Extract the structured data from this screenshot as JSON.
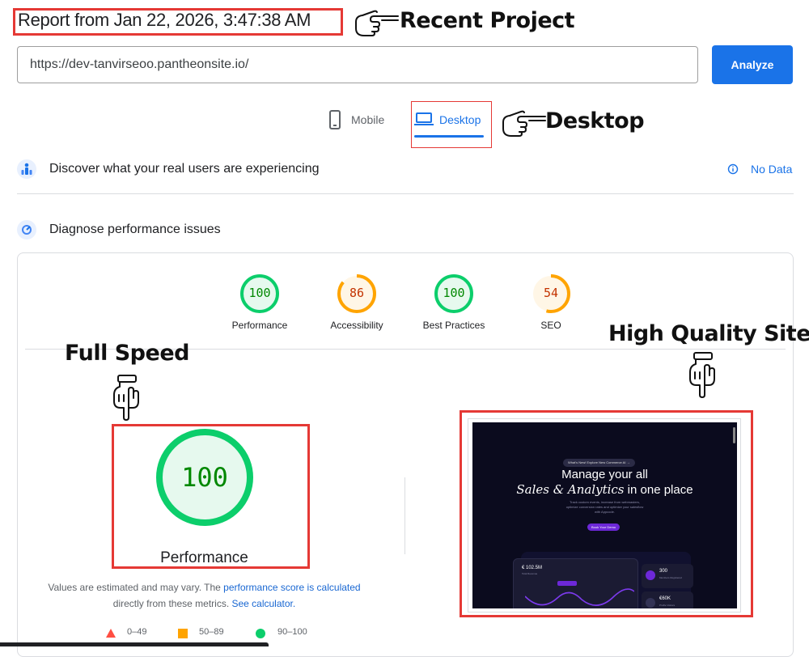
{
  "report": {
    "title": "Report from Jan 22, 2026, 3:47:38 AM"
  },
  "url_bar": {
    "value": "https://dev-tanvirseoo.pantheonsite.io/",
    "analyze_label": "Analyze"
  },
  "tabs": [
    {
      "label": "Mobile",
      "active": false
    },
    {
      "label": "Desktop",
      "active": true
    }
  ],
  "annotations": {
    "recent_project": "Recent Project",
    "desktop": "Desktop",
    "full_speed": "Full Speed",
    "high_quality": "High Quality Site"
  },
  "field_data": {
    "label": "Discover what your real users are experiencing",
    "status": "No Data"
  },
  "diagnose": {
    "label": "Diagnose performance issues"
  },
  "scores": [
    {
      "name": "Performance",
      "value": 100,
      "color": "#0cce6b"
    },
    {
      "name": "Accessibility",
      "value": 86,
      "color": "#ffa400"
    },
    {
      "name": "Best Practices",
      "value": 100,
      "color": "#0cce6b"
    },
    {
      "name": "SEO",
      "value": 54,
      "color": "#ffa400"
    }
  ],
  "big_gauge": {
    "value": "100",
    "label": "Performance"
  },
  "note": {
    "text1": "Values are estimated and may vary. The ",
    "link1": "performance score is calculated",
    "text2": " directly from these metrics. ",
    "link2": "See calculator."
  },
  "legend": [
    {
      "range": "0–49",
      "color": "#ff4e42"
    },
    {
      "range": "50–89",
      "color": "#ffa400"
    },
    {
      "range": "90–100",
      "color": "#0cce6b"
    }
  ],
  "screenshot": {
    "pill": "What's New!   Explore New Commerce AI  →",
    "headline1": "Manage your all",
    "headline2a": "Sales & Analytics",
    "headline2b": " in one place",
    "sub1": "Track custom events, increase from webmasters,",
    "sub2": "optimize conversion rates and optimize your salesflow",
    "sub3": "with Appcode.",
    "cta": "Book Your Demo",
    "revenue": "€ 102.5M",
    "revenue_label": "Total Revenue",
    "stat1": "300",
    "stat1_label": "Members Registered",
    "stat2": "€60K",
    "stat2_label": "Profile Visitors"
  },
  "colors": {
    "accent": "#1a73e8",
    "annotation_red": "#e53935"
  }
}
